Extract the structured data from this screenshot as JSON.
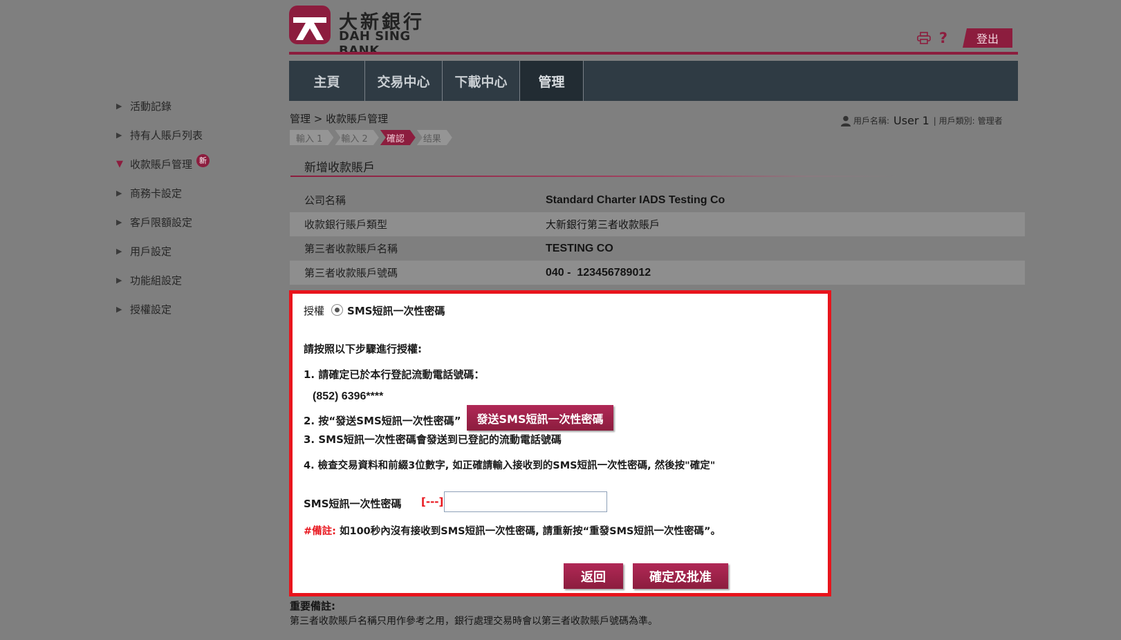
{
  "brand": {
    "name_cn": "大新銀行",
    "name_en": "DAH SING BANK",
    "color": "#8c1d3e"
  },
  "header": {
    "print_icon": "printer-icon",
    "help_label": "?",
    "logout_label": "登出"
  },
  "nav": {
    "tabs": [
      {
        "label": "主頁",
        "active": false
      },
      {
        "label": "交易中心",
        "active": false
      },
      {
        "label": "下載中心",
        "active": false
      },
      {
        "label": "管理",
        "active": true
      }
    ]
  },
  "sidebar": {
    "items": [
      {
        "label": "活動記錄"
      },
      {
        "label": "持有人賬戶列表"
      },
      {
        "label": "收款賬戶管理",
        "expanded": true,
        "badge": "新"
      },
      {
        "label": "商務卡設定"
      },
      {
        "label": "客戶限額設定"
      },
      {
        "label": "用戶設定"
      },
      {
        "label": "功能組設定"
      },
      {
        "label": "授權設定"
      }
    ]
  },
  "breadcrumb": "管理 > 收款賬戶管理",
  "user": {
    "name_label": "用戶名稱:",
    "name": "User 1",
    "type_label": "| 用戶類別:",
    "type": "管理者"
  },
  "steps": [
    {
      "label": "輸入 1"
    },
    {
      "label": "輸入 2"
    },
    {
      "label": "確認",
      "current": true
    },
    {
      "label": "结果"
    }
  ],
  "section_title": "新增收款賬戶",
  "details": [
    {
      "label": "公司名稱",
      "value": "Standard Charter IADS Testing Co"
    },
    {
      "label": "收款銀行賬戶類型",
      "value": "大新銀行第三者收款賬戶"
    },
    {
      "label": "第三者收款賬戶名稱",
      "value": "TESTING CO"
    },
    {
      "label": "第三者收款賬戶號碼",
      "value": "040 -  123456789012"
    }
  ],
  "auth": {
    "label": "授權",
    "method": "SMS短訊一次性密碼",
    "instructions_title": "請按照以下步驟進行授權:",
    "step1": "1. 請確定已於本行登記流動電話號碼：",
    "phone": "(852) 6396****",
    "step2": "2. 按“發送SMS短訊一次性密碼”",
    "send_button": "發送SMS短訊一次性密碼",
    "step3": "3. SMS短訊一次性密碼會發送到已登記的流動電話號碼",
    "step4": "4. 檢查交易資料和前綴3位數字, 如正確請輸入接收到的SMS短訊一次性密碼, 然後按\"確定\"",
    "otp_label": "SMS短訊一次性密碼",
    "otp_prefix": "[---]",
    "otp_value": "",
    "note_label": "#備註:",
    "note_text": " 如100秒內沒有接收到SMS短訊一次性密碼, 請重新按“重發SMS短訊一次性密碼”。",
    "back_button": "返回",
    "confirm_button": "確定及批准"
  },
  "important": {
    "title": "重要備註:",
    "text": "第三者收款賬戶名稱只用作參考之用，銀行處理交易時會以第三者收款賬戶號碼為準。"
  }
}
